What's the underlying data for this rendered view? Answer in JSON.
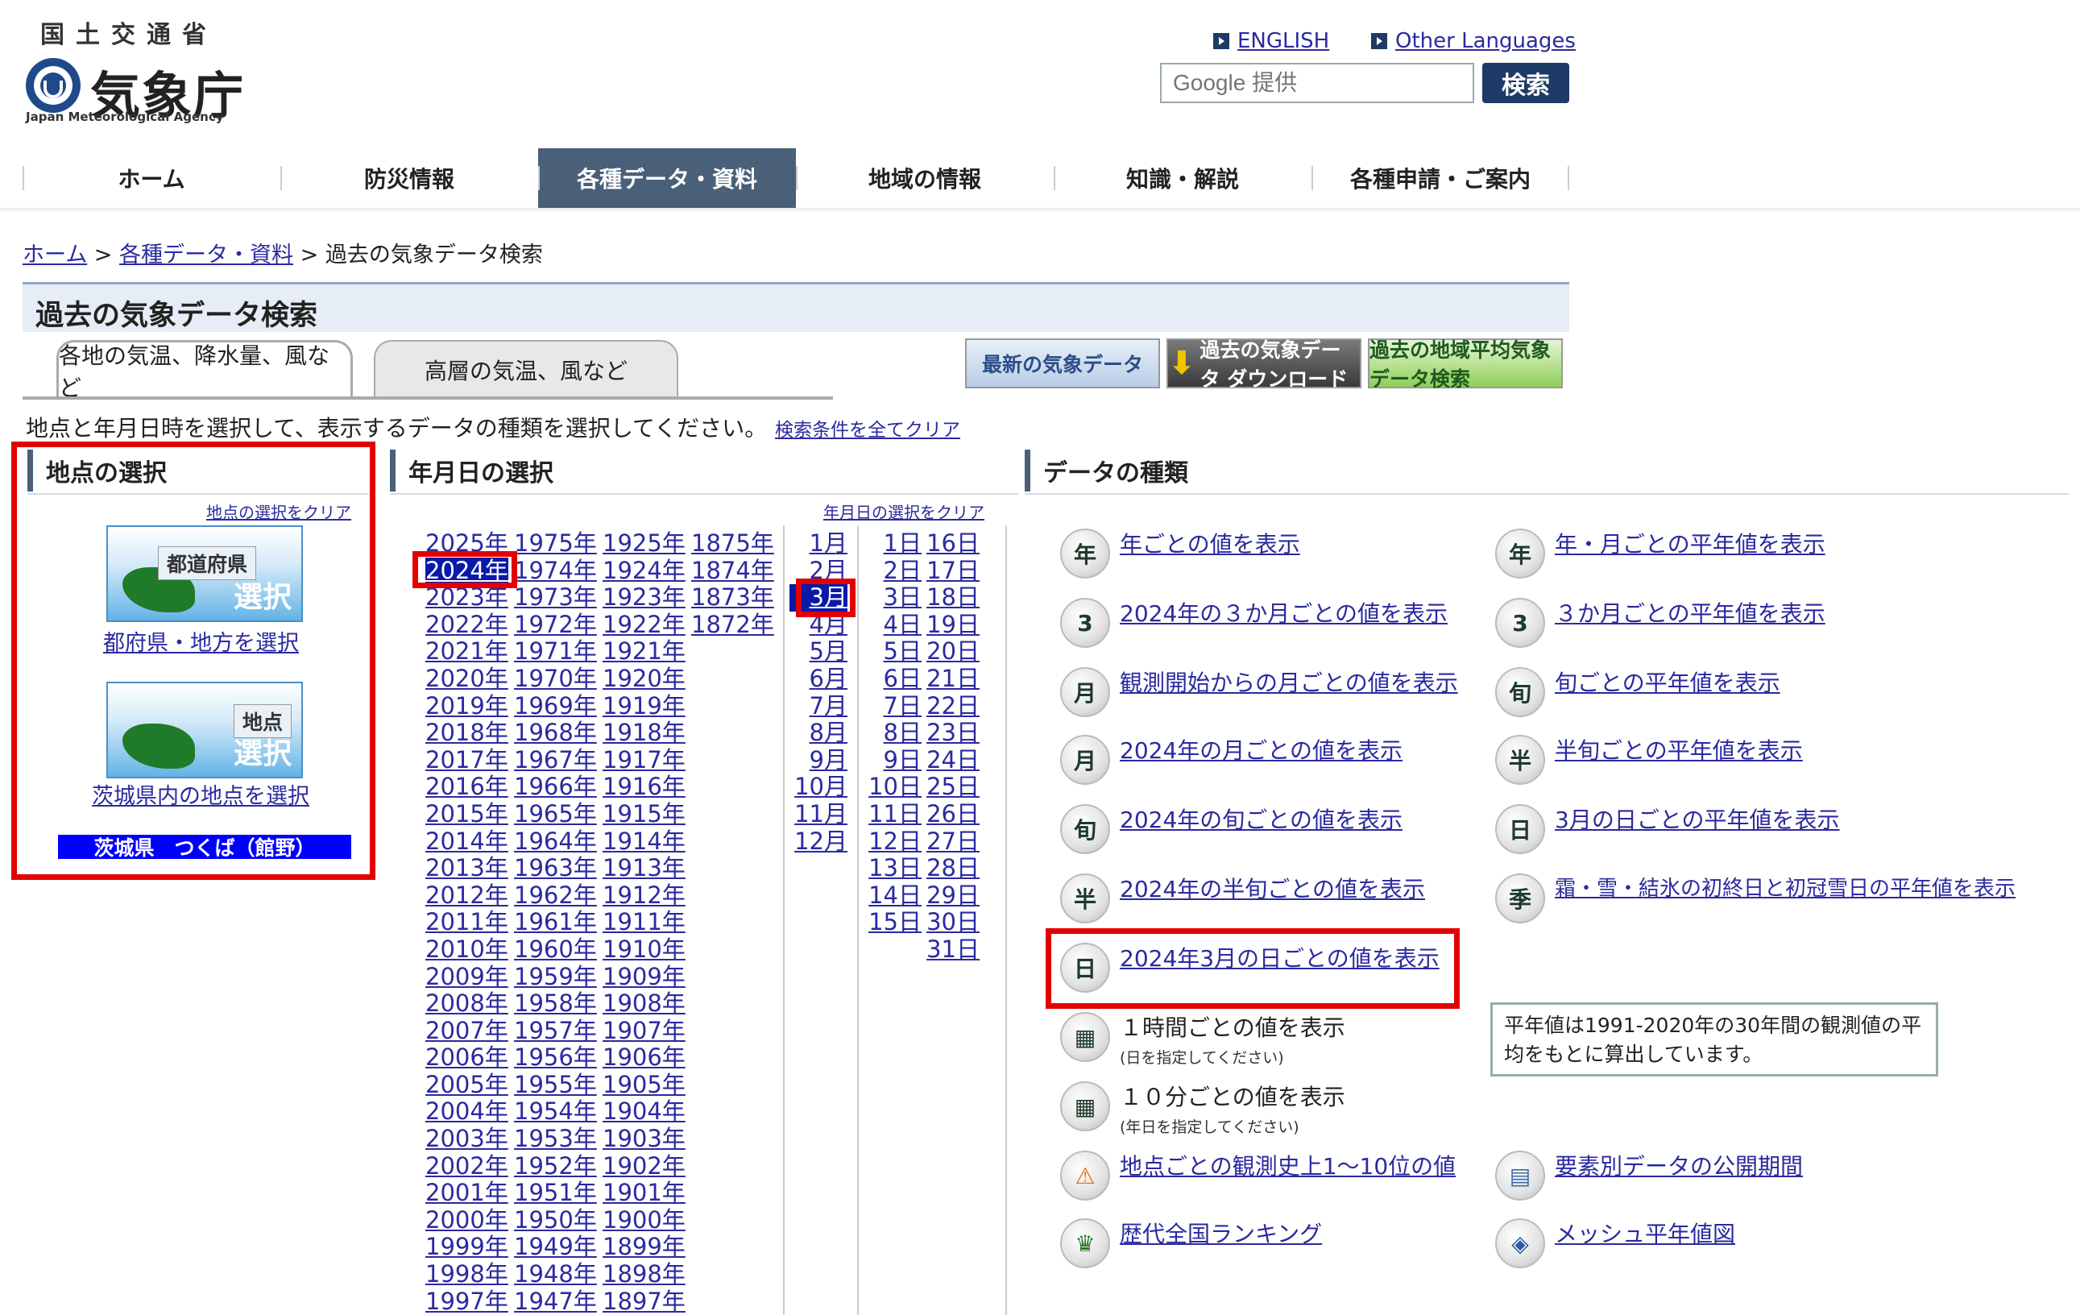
{
  "header": {
    "ministry": "国土交通省",
    "agency": "気象庁",
    "agency_en": "Japan Meteorological Agency",
    "lang_english": "ENGLISH",
    "lang_other": "Other Languages",
    "search_placeholder": "Google 提供",
    "search_button": "検索"
  },
  "nav": [
    "ホーム",
    "防災情報",
    "各種データ・資料",
    "地域の情報",
    "知識・解説",
    "各種申請・ご案内"
  ],
  "breadcrumb": {
    "home": "ホーム",
    "data": "各種データ・資料",
    "sep": ">",
    "current": "過去の気象データ検索"
  },
  "page_title": "過去の気象データ検索",
  "tabs": {
    "surface": "各地の気温、降水量、風など",
    "upper": "高層の気温、風など"
  },
  "banners": {
    "latest": "最新の気象データ",
    "download": "過去の気象データ ダウンロード",
    "normal": "過去の地域平均気象データ検索"
  },
  "instruction": "地点と年月日時を選択して、表示するデータの種類を選択してください。",
  "clear_all": "検索条件を全てクリア",
  "station": {
    "heading": "地点の選択",
    "clear": "地点の選択をクリア",
    "pref_img_tag": "都道府県",
    "pref_img_word": "選択",
    "pref_link": "都府県・地方を選択",
    "station_img_tag": "地点",
    "station_img_word": "選択",
    "station_link": "茨城県内の地点を選択",
    "selected": "茨城県　つくば（館野）"
  },
  "date": {
    "heading": "年月日の選択",
    "clear": "年月日の選択をクリア",
    "years_col1": [
      "2025年",
      "2024年",
      "2023年",
      "2022年",
      "2021年",
      "2020年",
      "2019年",
      "2018年",
      "2017年",
      "2016年",
      "2015年",
      "2014年",
      "2013年",
      "2012年",
      "2011年",
      "2010年",
      "2009年",
      "2008年",
      "2007年",
      "2006年",
      "2005年",
      "2004年",
      "2003年",
      "2002年",
      "2001年",
      "2000年",
      "1999年",
      "1998年",
      "1997年"
    ],
    "years_col2": [
      "1975年",
      "1974年",
      "1973年",
      "1972年",
      "1971年",
      "1970年",
      "1969年",
      "1968年",
      "1967年",
      "1966年",
      "1965年",
      "1964年",
      "1963年",
      "1962年",
      "1961年",
      "1960年",
      "1959年",
      "1958年",
      "1957年",
      "1956年",
      "1955年",
      "1954年",
      "1953年",
      "1952年",
      "1951年",
      "1950年",
      "1949年",
      "1948年",
      "1947年"
    ],
    "years_col3": [
      "1925年",
      "1924年",
      "1923年",
      "1922年",
      "1921年",
      "1920年",
      "1919年",
      "1918年",
      "1917年",
      "1916年",
      "1915年",
      "1914年",
      "1913年",
      "1912年",
      "1911年",
      "1910年",
      "1909年",
      "1908年",
      "1907年",
      "1906年",
      "1905年",
      "1904年",
      "1903年",
      "1902年",
      "1901年",
      "1900年",
      "1899年",
      "1898年",
      "1897年"
    ],
    "years_col4": [
      "1875年",
      "1874年",
      "1873年",
      "1872年"
    ],
    "months": [
      "1月",
      "2月",
      "3月",
      "4月",
      "5月",
      "6月",
      "7月",
      "8月",
      "9月",
      "10月",
      "11月",
      "12月"
    ],
    "days_col1": [
      "1日",
      "2日",
      "3日",
      "4日",
      "5日",
      "6日",
      "7日",
      "8日",
      "9日",
      "10日",
      "11日",
      "12日",
      "13日",
      "14日",
      "15日"
    ],
    "days_col2": [
      "16日",
      "17日",
      "18日",
      "19日",
      "20日",
      "21日",
      "22日",
      "23日",
      "24日",
      "25日",
      "26日",
      "27日",
      "28日",
      "29日",
      "30日",
      "31日"
    ],
    "selected_year": "2024年",
    "selected_month": "3月"
  },
  "datatype": {
    "heading": "データの種類",
    "left": [
      {
        "icon": "年",
        "label": "年ごとの値を表示"
      },
      {
        "icon": "3",
        "label": "2024年の３か月ごとの値を表示"
      },
      {
        "icon": "月",
        "label": "観測開始からの月ごとの値を表示"
      },
      {
        "icon": "月",
        "label": "2024年の月ごとの値を表示"
      },
      {
        "icon": "旬",
        "label": "2024年の旬ごとの値を表示"
      },
      {
        "icon": "半",
        "label": "2024年の半旬ごとの値を表示"
      },
      {
        "icon": "日",
        "label": "2024年3月の日ごとの値を表示"
      }
    ],
    "hourly": {
      "label": "１時間ごとの値を表示",
      "note": "(日を指定してください)"
    },
    "ten_min": {
      "label": "１０分ごとの値を表示",
      "note": "(年日を指定してください)"
    },
    "ranking_station": "地点ごとの観測史上1～10位の値",
    "ranking_nation": "歴代全国ランキング",
    "right": [
      {
        "icon": "年",
        "label": "年・月ごとの平年値を表示"
      },
      {
        "icon": "3",
        "label": "３か月ごとの平年値を表示"
      },
      {
        "icon": "旬",
        "label": "旬ごとの平年値を表示"
      },
      {
        "icon": "半",
        "label": "半旬ごとの平年値を表示"
      },
      {
        "icon": "日",
        "label": "3月の日ごとの平年値を表示"
      },
      {
        "icon": "季",
        "label": "霜・雪・結氷の初終日と初冠雪日の平年値を表示"
      }
    ],
    "period": "要素別データの公開期間",
    "mesh": "メッシュ平年値図",
    "normal_note": "平年値は1991-2020年の30年間の観測値の平均をもとに算出しています。"
  }
}
